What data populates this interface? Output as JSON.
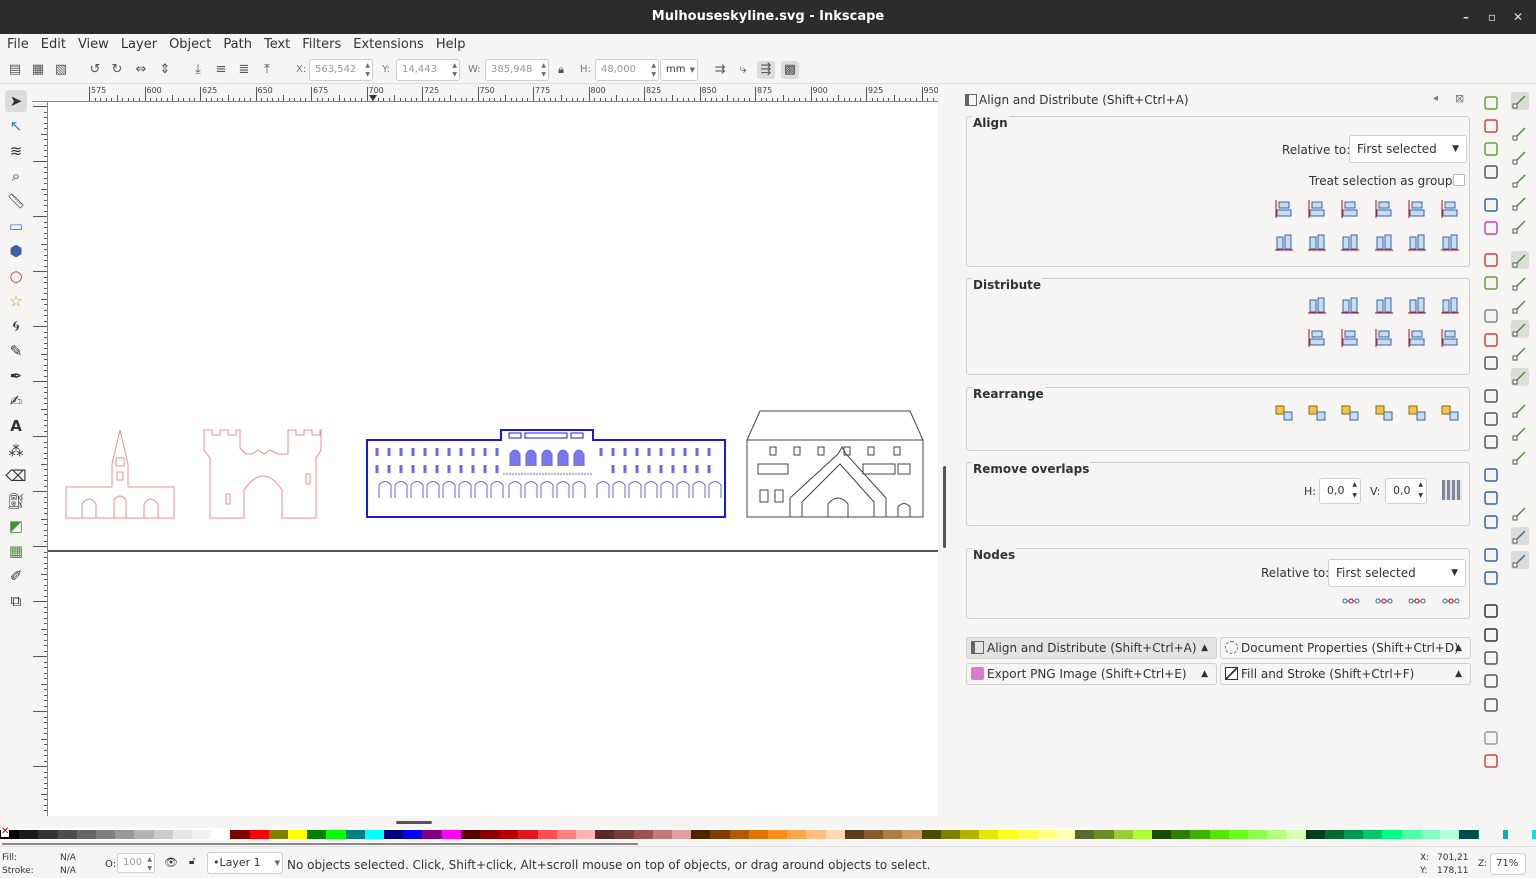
{
  "window": {
    "title": "Mulhouseskyline.svg - Inkscape",
    "controls": [
      "–",
      "▫",
      "✕"
    ]
  },
  "menu": [
    "File",
    "Edit",
    "View",
    "Layer",
    "Object",
    "Path",
    "Text",
    "Filters",
    "Extensions",
    "Help"
  ],
  "toolbar": {
    "x_label": "X:",
    "x_value": "563,542",
    "y_label": "Y:",
    "y_value": "14,443",
    "w_label": "W:",
    "w_value": "385,948",
    "h_label": "H:",
    "h_value": "48,000",
    "unit": "mm"
  },
  "ruler": {
    "h_labels": [
      "575",
      "600",
      "625",
      "650",
      "675",
      "700",
      "725",
      "750",
      "775",
      "800",
      "825",
      "850",
      "875",
      "900",
      "925",
      "950"
    ]
  },
  "panel": {
    "title": "Align and Distribute (Shift+Ctrl+A)",
    "align": {
      "title": "Align",
      "relative_label": "Relative to:",
      "relative_value": "First selected",
      "group_label": "Treat selection as group:"
    },
    "distribute": {
      "title": "Distribute"
    },
    "rearrange": {
      "title": "Rearrange"
    },
    "overlaps": {
      "title": "Remove overlaps",
      "h_label": "H:",
      "h_value": "0,0",
      "v_label": "V:",
      "v_value": "0,0"
    },
    "nodes": {
      "title": "Nodes",
      "relative_label": "Relative to:",
      "relative_value": "First selected"
    },
    "tabs": [
      "Align and Distribute (Shift+Ctrl+A)",
      "Document Properties (Shift+Ctrl+D)",
      "Export PNG Image (Shift+Ctrl+E)",
      "Fill and Stroke (Shift+Ctrl+F)"
    ]
  },
  "status": {
    "fill_label": "Fill:",
    "fill_value": "N/A",
    "stroke_label": "Stroke:",
    "stroke_value": "N/A",
    "opacity_label": "O:",
    "opacity_value": "100",
    "layer": "•Layer 1",
    "message": "No objects selected. Click, Shift+click, Alt+scroll mouse on top of objects, or drag around objects to select.",
    "cursor_x_label": "X:",
    "cursor_x": "701,21",
    "cursor_y_label": "Y:",
    "cursor_y": "178,11",
    "zoom_label": "Z:",
    "zoom": "71%"
  },
  "colors": {
    "accent": "#2d7dd2",
    "selection": "#1a1adc",
    "light_red": "#f08c8c",
    "dark": "#2c2c2c"
  }
}
